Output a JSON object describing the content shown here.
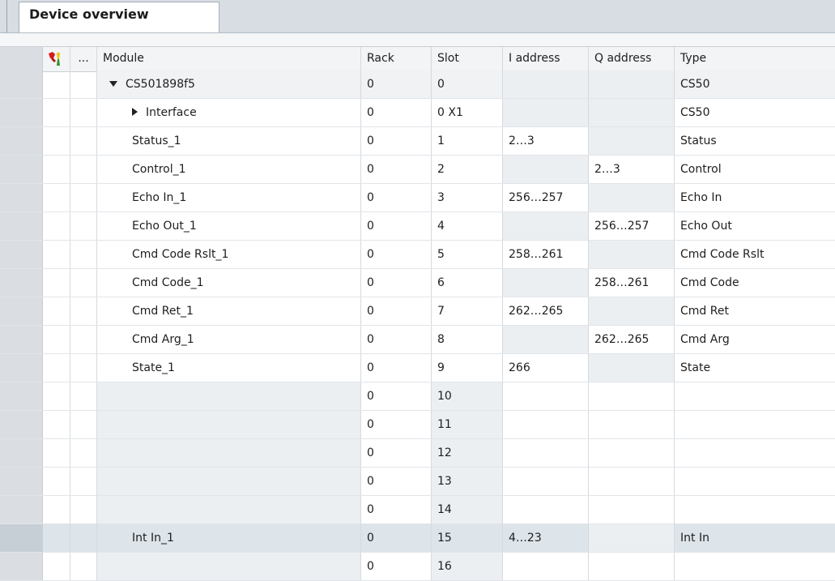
{
  "tab": {
    "label": "Device overview"
  },
  "columns": {
    "flag": "",
    "more": "...",
    "module": "Module",
    "rack": "Rack",
    "slot": "Slot",
    "iaddress": "I address",
    "qaddress": "Q address",
    "type": "Type"
  },
  "rows": [
    {
      "module": "CS501898f5",
      "rack": "0",
      "slot": "0",
      "iaddr": "",
      "qaddr": "",
      "type": "CS50"
    },
    {
      "module": "Interface",
      "rack": "0",
      "slot": "0 X1",
      "iaddr": "",
      "qaddr": "",
      "type": "CS50"
    },
    {
      "module": "Status_1",
      "rack": "0",
      "slot": "1",
      "iaddr": "2…3",
      "qaddr": "",
      "type": "Status"
    },
    {
      "module": "Control_1",
      "rack": "0",
      "slot": "2",
      "iaddr": "",
      "qaddr": "2…3",
      "type": "Control"
    },
    {
      "module": "Echo In_1",
      "rack": "0",
      "slot": "3",
      "iaddr": "256…257",
      "qaddr": "",
      "type": "Echo In"
    },
    {
      "module": "Echo Out_1",
      "rack": "0",
      "slot": "4",
      "iaddr": "",
      "qaddr": "256…257",
      "type": "Echo Out"
    },
    {
      "module": "Cmd Code Rslt_1",
      "rack": "0",
      "slot": "5",
      "iaddr": "258…261",
      "qaddr": "",
      "type": "Cmd Code Rslt"
    },
    {
      "module": "Cmd Code_1",
      "rack": "0",
      "slot": "6",
      "iaddr": "",
      "qaddr": "258…261",
      "type": "Cmd Code"
    },
    {
      "module": "Cmd Ret_1",
      "rack": "0",
      "slot": "7",
      "iaddr": "262…265",
      "qaddr": "",
      "type": "Cmd Ret"
    },
    {
      "module": "Cmd Arg_1",
      "rack": "0",
      "slot": "8",
      "iaddr": "",
      "qaddr": "262…265",
      "type": "Cmd Arg"
    },
    {
      "module": "State_1",
      "rack": "0",
      "slot": "9",
      "iaddr": "266",
      "qaddr": "",
      "type": "State"
    },
    {
      "module": "",
      "rack": "0",
      "slot": "10",
      "iaddr": "",
      "qaddr": "",
      "type": ""
    },
    {
      "module": "",
      "rack": "0",
      "slot": "11",
      "iaddr": "",
      "qaddr": "",
      "type": ""
    },
    {
      "module": "",
      "rack": "0",
      "slot": "12",
      "iaddr": "",
      "qaddr": "",
      "type": ""
    },
    {
      "module": "",
      "rack": "0",
      "slot": "13",
      "iaddr": "",
      "qaddr": "",
      "type": ""
    },
    {
      "module": "",
      "rack": "0",
      "slot": "14",
      "iaddr": "",
      "qaddr": "",
      "type": ""
    },
    {
      "module": "Int In_1",
      "rack": "0",
      "slot": "15",
      "iaddr": "4…23",
      "qaddr": "",
      "type": "Int In"
    },
    {
      "module": "",
      "rack": "0",
      "slot": "16",
      "iaddr": "",
      "qaddr": "",
      "type": ""
    }
  ]
}
